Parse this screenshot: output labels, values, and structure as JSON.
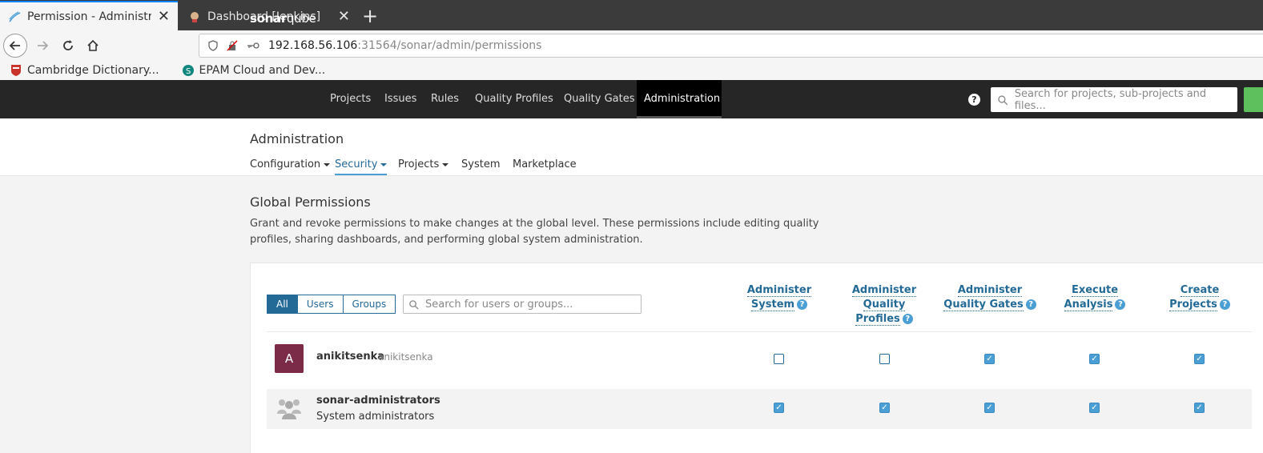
{
  "browser": {
    "tabs": [
      {
        "title": "Permission - Administrat",
        "close": "✕"
      },
      {
        "title": "Dashboard [Jenkins]",
        "close": "✕"
      }
    ],
    "new_tab": "+",
    "url_host": "192.168.56.106",
    "url_rest": ":31564/sonar/admin/permissions",
    "bookmarks": [
      "Cambridge Dictionary...",
      "EPAM Cloud and Dev..."
    ]
  },
  "sonar": {
    "logo_bold": "sonar",
    "logo_light": "qube",
    "nav": [
      "Projects",
      "Issues",
      "Rules",
      "Quality Profiles",
      "Quality Gates",
      "Administration"
    ],
    "help": "?",
    "search_placeholder": "Search for projects, sub-projects and files..."
  },
  "admin": {
    "title": "Administration",
    "subnav": [
      "Configuration",
      "Security",
      "Projects",
      "System",
      "Marketplace"
    ]
  },
  "page": {
    "title": "Global Permissions",
    "description": "Grant and revoke permissions to make changes at the global level. These permissions include editing quality profiles, sharing dashboards, and performing global system administration."
  },
  "filter": {
    "buttons": [
      "All",
      "Users",
      "Groups"
    ],
    "search_placeholder": "Search for users or groups..."
  },
  "columns": [
    [
      "Administer",
      "System"
    ],
    [
      "Administer",
      "Quality",
      "Profiles"
    ],
    [
      "Administer",
      "Quality Gates"
    ],
    [
      "Execute",
      "Analysis"
    ],
    [
      "Create",
      "Projects"
    ]
  ],
  "rows": [
    {
      "avatar": "A",
      "name": "anikitsenka",
      "login": "anikitsenka",
      "perms": [
        false,
        false,
        true,
        true,
        true
      ]
    },
    {
      "name": "sonar-administrators",
      "description": "System administrators",
      "perms": [
        true,
        true,
        true,
        true,
        true
      ]
    }
  ],
  "colors": {
    "accent": "#236a97",
    "checkbox": "#4b9fd5",
    "nav_bg": "#262626",
    "avatar_bg": "#7b2a48"
  }
}
